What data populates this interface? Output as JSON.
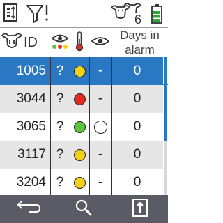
{
  "toolbar": {
    "sort_icon": "sort-options-icon",
    "filter_icon": "filter-alert-icon",
    "animals_icon": "cows-icon",
    "animal_count": "6",
    "battery_icon": "battery-icon",
    "battery_level": 0.75
  },
  "table": {
    "headers": {
      "id": "ID",
      "id_icon": "cow-head-icon",
      "heat_icon": "eye-status-dots-icon",
      "temp_icon": "thermometer-icon",
      "watch_icon": "eye-icon",
      "days_line1": "Days in",
      "days_line2": "alarm"
    },
    "rows": [
      {
        "id": "1005",
        "q": "?",
        "temp_status": "yellow",
        "watch": "-",
        "days": "0",
        "selected": true
      },
      {
        "id": "3044",
        "q": "?",
        "temp_status": "red",
        "watch": "-",
        "days": "0",
        "selected": false
      },
      {
        "id": "3065",
        "q": "?",
        "temp_status": "green",
        "watch": "empty-circle",
        "days": "0",
        "selected": false
      },
      {
        "id": "3117",
        "q": "?",
        "temp_status": "yellow",
        "watch": "-",
        "days": "0",
        "selected": false
      },
      {
        "id": "3204",
        "q": "?",
        "temp_status": "yellow",
        "watch": "-",
        "days": "0",
        "selected": false
      }
    ]
  },
  "bottombar": {
    "back_icon": "back-arrow-icon",
    "search_icon": "search-icon",
    "select_icon": "select-up-icon"
  },
  "colors": {
    "selected_row": "#2a78c4",
    "alt_row": "#e6e6e6",
    "bottom_bar": "#5b5b66",
    "yellow": "#f2d014",
    "red": "#e8281e",
    "green": "#5cc23a",
    "battery_green": "#2fa83a"
  }
}
